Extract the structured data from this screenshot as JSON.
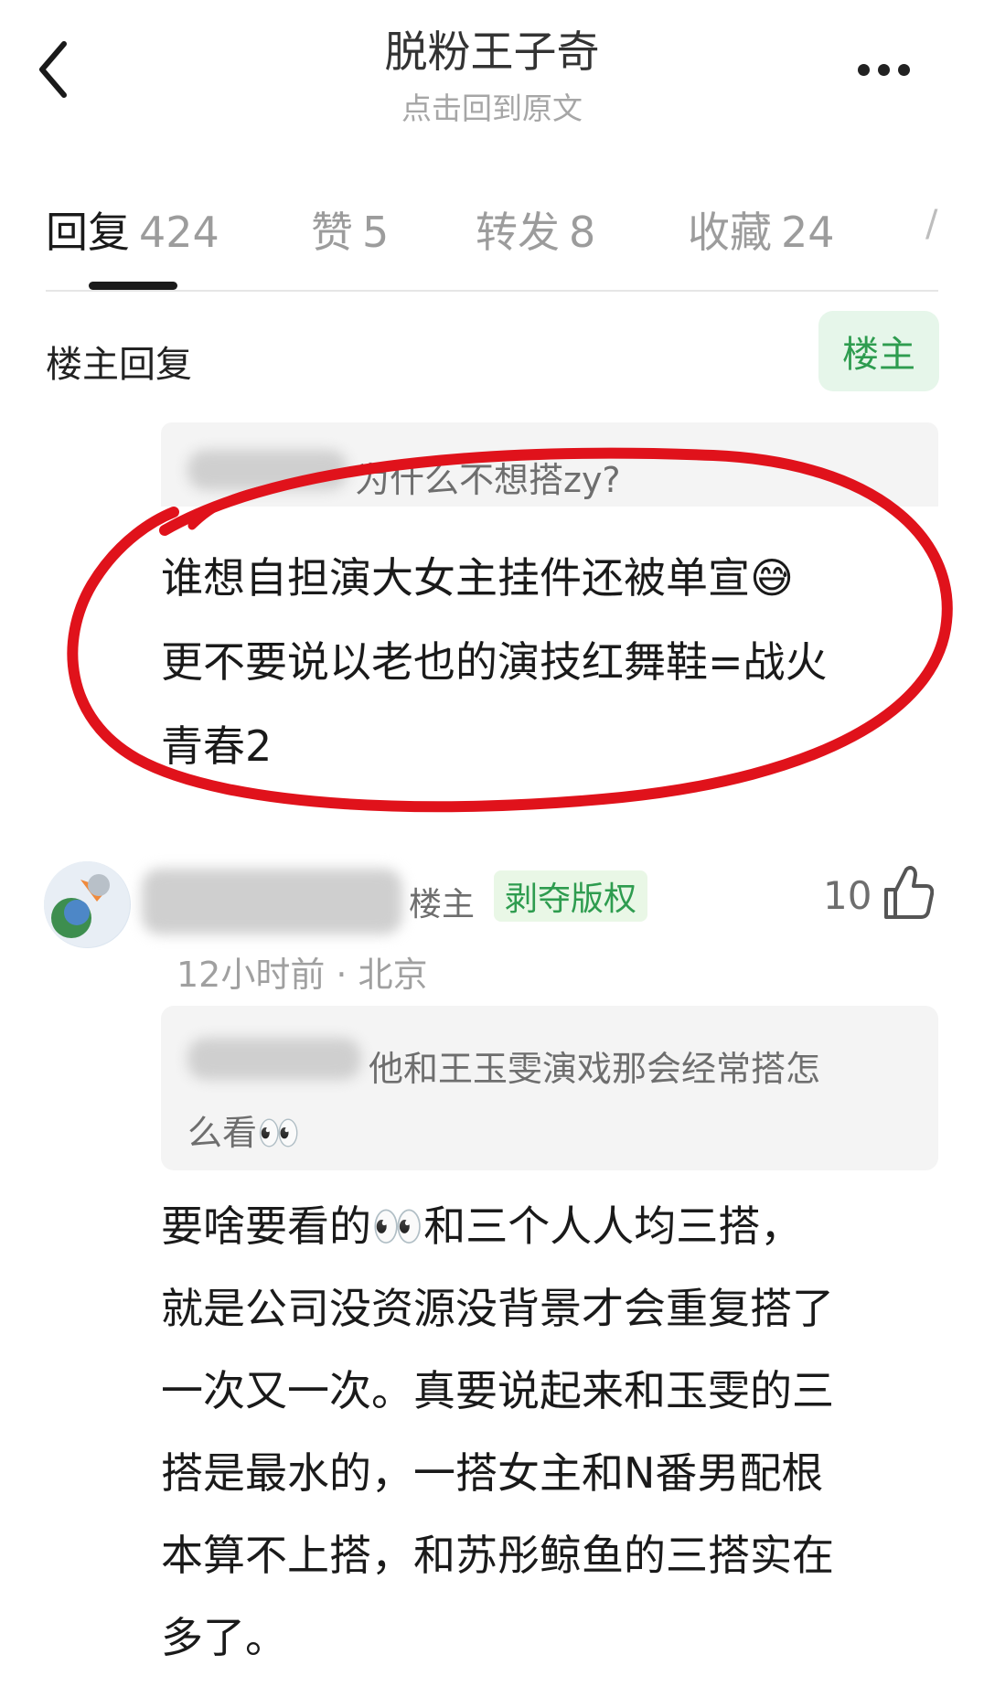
{
  "header": {
    "title": "脱粉王子奇",
    "subtitle": "点击回到原文"
  },
  "tabs": [
    {
      "label": "回复",
      "count": "424"
    },
    {
      "label": "赞",
      "count": "5"
    },
    {
      "label": "转发",
      "count": "8"
    },
    {
      "label": "收藏",
      "count": "24"
    }
  ],
  "section": {
    "title": "楼主回复",
    "op_badge": "楼主"
  },
  "op_post": {
    "quoted_text": "为什么不想搭zy?",
    "lines": [
      "谁想自担演大女主挂件还被单宣😅",
      "更不要说以老也的演技红舞鞋=战火",
      "青春2"
    ]
  },
  "comment": {
    "tag_op": "楼主",
    "tag_title": "剥夺版权",
    "likes": "10",
    "meta": "12小时前 · 北京",
    "quoted_lines": [
      "他和王玉雯演戏那会经常搭怎",
      "么看👀"
    ],
    "body_lines": [
      "要啥要看的👀和三个人人均三搭，",
      "就是公司没资源没背景才会重复搭了",
      "一次又一次。真要说起来和玉雯的三",
      "搭是最水的，一搭女主和N番男配根",
      "本算不上搭，和苏彤鲸鱼的三搭实在",
      "多了。"
    ]
  },
  "colors": {
    "accent_green": "#2e9c4f",
    "annotation_red": "#e0121b"
  },
  "icons": [
    "back-arrow-icon",
    "more-dots-icon",
    "thumbs-up-icon"
  ]
}
